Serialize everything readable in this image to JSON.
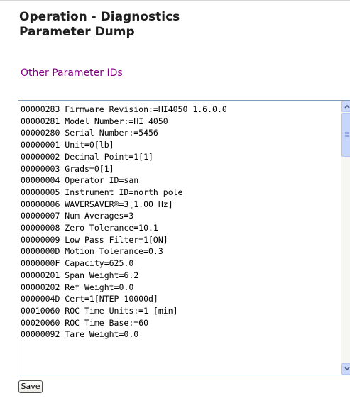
{
  "page": {
    "title_line1": "Operation - Diagnostics",
    "title_line2": "Parameter Dump",
    "other_link": "Other Parameter IDs"
  },
  "dump": {
    "lines": [
      "00000283 Firmware Revision:=HI4050 1.6.0.0",
      "00000281 Model Number:=HI 4050",
      "00000280 Serial Number:=5456",
      "00000001 Unit=0[lb]",
      "00000002 Decimal Point=1[1]",
      "00000003 Grads=0[1]",
      "00000004 Operator ID=san",
      "00000005 Instrument ID=north pole",
      "00000006 WAVERSAVER®=3[1.00 Hz]",
      "00000007 Num Averages=3",
      "00000008 Zero Tolerance=10.1",
      "00000009 Low Pass Filter=1[ON]",
      "0000000D Motion Tolerance=0.3",
      "0000000F Capacity=625.0",
      "00000201 Span Weight=6.2",
      "00000202 Ref Weight=0.0",
      "0000004D Cert=1[NTEP 10000d]",
      "00010060 ROC Time Units:=1 [min]",
      "00020060 ROC Time Base:=60",
      "00000092 Tare Weight=0.0"
    ]
  },
  "scrollbar": {
    "position": 0.0
  },
  "form": {
    "save_label": "Save"
  }
}
